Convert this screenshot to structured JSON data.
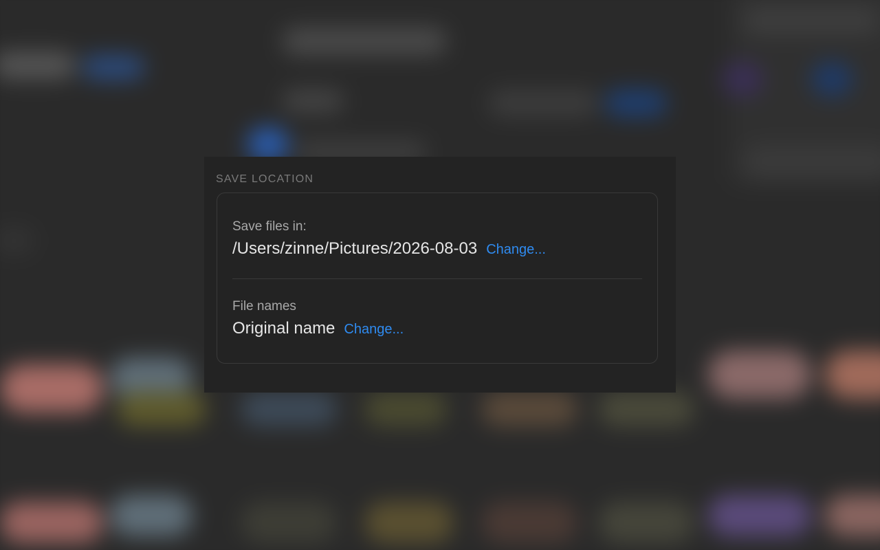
{
  "save_location": {
    "section_label": "SAVE LOCATION",
    "folder": {
      "label": "Save files in:",
      "value": "/Users/zinne/Pictures/2026-08-03",
      "change_label": "Change..."
    },
    "file_names": {
      "label": "File names",
      "value": "Original name",
      "change_label": "Change..."
    }
  },
  "colors": {
    "link": "#2f8bf0",
    "panel_bg": "#232323",
    "text_primary": "#e6e6e6",
    "text_secondary": "#a9a9a9"
  }
}
